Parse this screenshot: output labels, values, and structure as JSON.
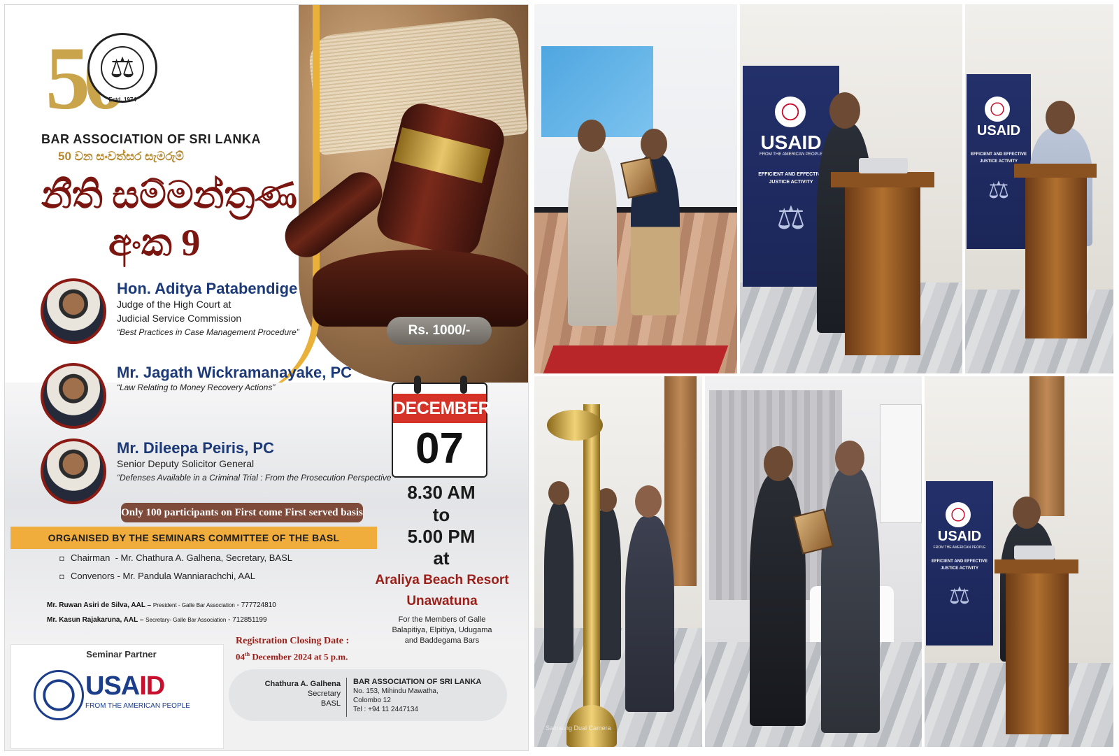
{
  "poster": {
    "logo_number": "50",
    "emblem_estd": "Estd. 1974",
    "org_name": "BAR ASSOCIATION OF SRI LANKA",
    "anniversary": "50 වන සංවත්සර සැමරුම්",
    "title_line1": "නීති සම්මන්ත්‍රණ",
    "title_line2": "අංක 9",
    "price": "Rs. 1000/-",
    "speakers": [
      {
        "name": "Hon. Aditya Patabendige",
        "line1": "Judge of the High Court at",
        "line2": "Judicial Service Commission",
        "topic": "“Best Practices in Case Management Procedure”"
      },
      {
        "name": "Mr. Jagath Wickramanayake, PC",
        "topic": "“Law Relating to Money Recovery Actions”"
      },
      {
        "name": "Mr. Dileepa Peiris, PC",
        "line1": "Senior Deputy Solicitor General",
        "topic": "“Defenses Available in a Criminal Trial : From the Prosecution Perspective”"
      }
    ],
    "calendar": {
      "month": "DECEMBER",
      "day": "07"
    },
    "time": {
      "start": "8.30 AM",
      "to": "to",
      "end": "5.00 PM",
      "at": "at"
    },
    "venue": {
      "name": "Araliya Beach Resort",
      "place": "Unawatuna"
    },
    "members_note": {
      "line1": "For the Members of Galle",
      "line2": "Balapitiya, Elpitiya, Udugama",
      "line3": "and Baddegama Bars"
    },
    "participants_note": "Only 100 participants on First come First served basis",
    "organised_by": "ORGANISED BY THE SEMINARS COMMITTEE OF THE BASL",
    "committee": [
      {
        "role": "Chairman",
        "detail": "- Mr. Chathura A. Galhena, Secretary, BASL"
      },
      {
        "role": "Convenors",
        "detail": "- Mr. Pandula Wanniarachchi, AAL"
      }
    ],
    "contacts": [
      {
        "name": "Mr. Ruwan Asiri de Silva, AAL –",
        "role": "President - Galle Bar Association",
        "phone": "- 777724810"
      },
      {
        "name": "Mr. Kasun Rajakaruna, AAL –",
        "role": "Secretary- Galle Bar Association",
        "phone": "- 712851199"
      }
    ],
    "partner": {
      "label": "Seminar Partner",
      "word_blue": "USA",
      "word_red": "ID",
      "sub": "FROM THE AMERICAN PEOPLE"
    },
    "registration": {
      "title": "Registration Closing Date :",
      "day": "04",
      "suffix": "th",
      "rest": " December 2024 at 5 p.m."
    },
    "signature": {
      "name": "Chathura A. Galhena",
      "title": "Secretary",
      "org_short": "BASL",
      "org": "BAR ASSOCIATION OF SRI LANKA",
      "address1": "No. 153, Mihindu Mawatha,",
      "address2": "Colombo 12",
      "tel": "Tel : +94 11 2447134"
    }
  },
  "photos": {
    "banner_word": "USAID",
    "banner_sub": "FROM THE AMERICAN PEOPLE",
    "banner_activity1": "EFFICIENT AND EFFECTIVE",
    "banner_activity2": "JUSTICE ACTIVITY",
    "watermark": "Samsung Dual Camera"
  },
  "colors": {
    "maroon": "#7a1510",
    "gold": "#e9b13a",
    "navy": "#1c3a78",
    "usaid_blue": "#1b3d8a",
    "usaid_red": "#c8102e",
    "calendar_red": "#d53327"
  }
}
